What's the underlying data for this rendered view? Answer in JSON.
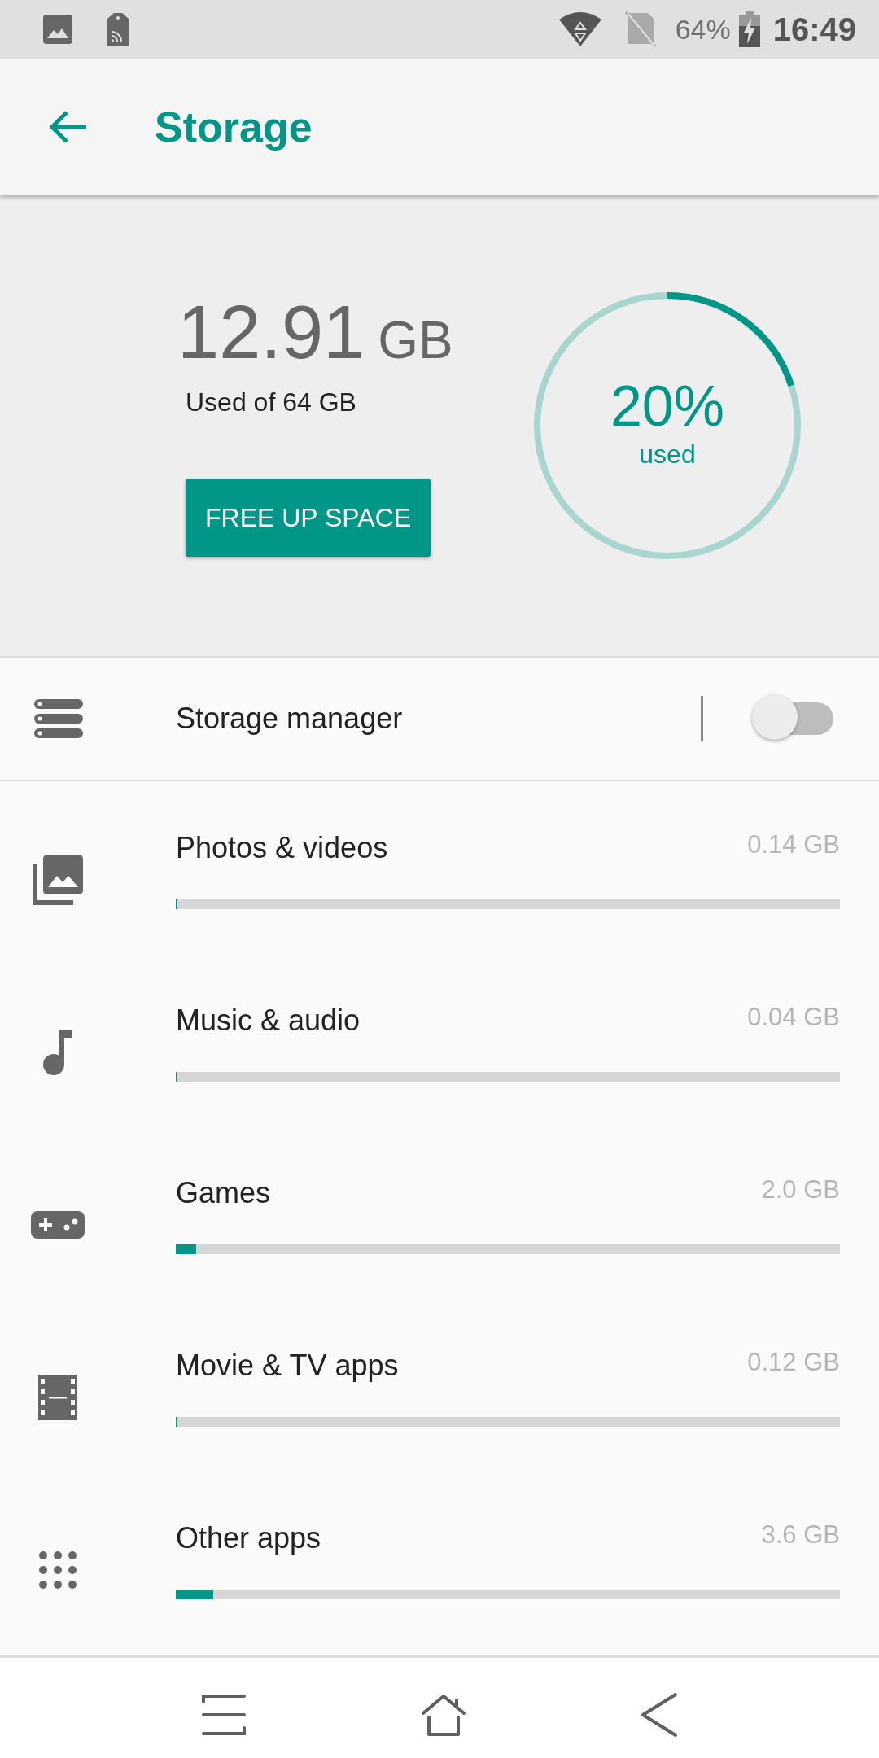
{
  "status_bar": {
    "battery": "64%",
    "time": "16:49"
  },
  "app_bar": {
    "title": "Storage"
  },
  "summary": {
    "used_amount": "12.91",
    "used_unit": "GB",
    "used_of": "Used of 64 GB",
    "button": "FREE UP SPACE",
    "percent": "20%",
    "percent_label": "used",
    "level": 0.2
  },
  "storage_manager": {
    "label": "Storage manager",
    "on": false
  },
  "categories": [
    {
      "name": "Photos & videos",
      "size": "0.14 GB",
      "level": 0.002
    },
    {
      "name": "Music & audio",
      "size": "0.04 GB",
      "level": 0.0006
    },
    {
      "name": "Games",
      "size": "2.0 GB",
      "level": 0.031
    },
    {
      "name": "Movie & TV apps",
      "size": "0.12 GB",
      "level": 0.002
    },
    {
      "name": "Other apps",
      "size": "3.6 GB",
      "level": 0.056
    }
  ]
}
